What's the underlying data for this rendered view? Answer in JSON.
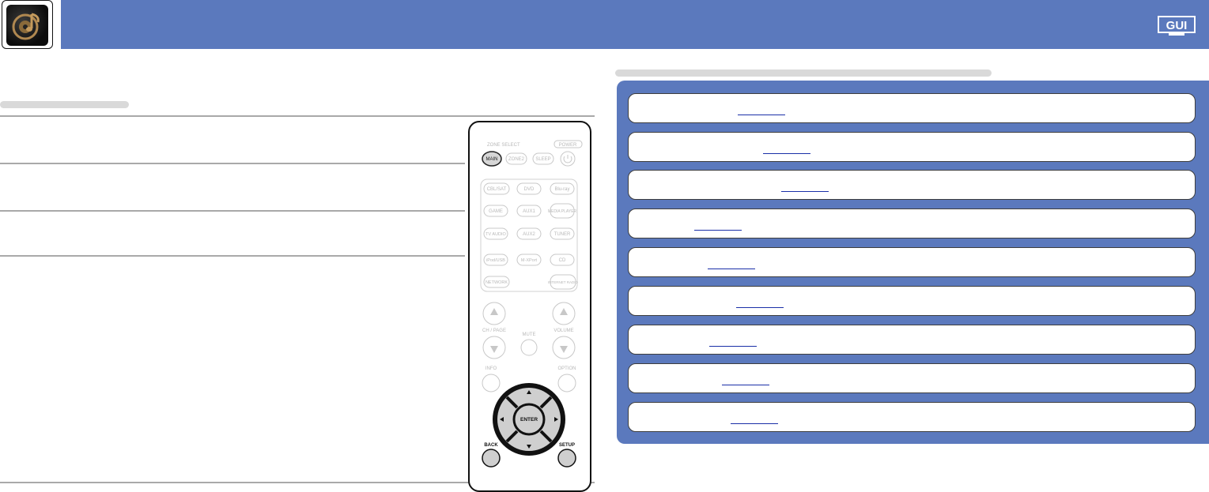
{
  "header": {
    "logo_icon": "music-disc-icon",
    "banner_color": "#5b79bd",
    "gui_badge": "GUI"
  },
  "remote": {
    "zone_select_label": "ZONE SELECT",
    "power_label": "POWER",
    "main_label": "MAIN",
    "zone2_label": "ZONE2",
    "sleep_label": "SLEEP",
    "sources": [
      "CBL/SAT",
      "DVD",
      "Blu-ray",
      "GAME",
      "AUX1",
      "MEDIA PLAYER",
      "TV AUDIO",
      "AUX2",
      "TUNER",
      "iPod/USB",
      "M-XPort",
      "CD",
      "NETWORK",
      "INTERNET RADIO"
    ],
    "ch_page_label": "CH / PAGE",
    "mute_label": "MUTE",
    "volume_label": "VOLUME",
    "info_label": "INFO",
    "option_label": "OPTION",
    "enter_label": "ENTER",
    "back_label": "BACK",
    "setup_label": "SETUP"
  }
}
